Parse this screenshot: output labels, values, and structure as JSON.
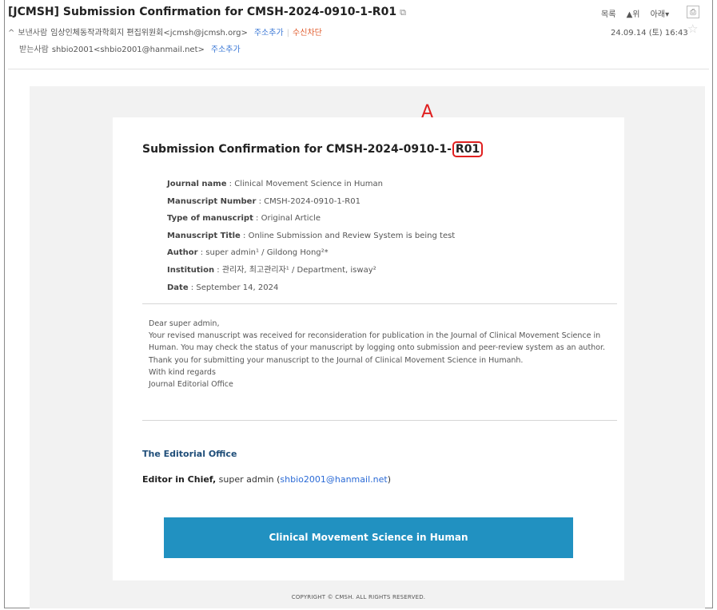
{
  "header": {
    "subject": "[JCMSH] Submission Confirmation for CMSH-2024-0910-1-R01",
    "sender_label": "보낸사람",
    "sender": "임상인체동작과학회지 편집위원회<jcmsh@jcmsh.org>",
    "recipient_label": "받는사람",
    "recipient": "shbio2001<shbio2001@hanmail.net>",
    "add_contact": "주소추가",
    "block_sender": "수신차단",
    "nav_list": "목록",
    "nav_up": "▲위",
    "nav_down": "아래▾",
    "received_at": "24.09.14 (토) 16:43"
  },
  "annotation": {
    "marker": "A"
  },
  "body": {
    "title_prefix": "Submission Confirmation for CMSH-2024-0910-1-",
    "title_suffix": "R01",
    "meta": [
      {
        "label": "Journal name",
        "value": " : Clinical Movement Science in Human"
      },
      {
        "label": "Manuscript Number",
        "value": " : CMSH-2024-0910-1-R01"
      },
      {
        "label": "Type of manuscript",
        "value": " : Original Article"
      },
      {
        "label": "Manuscript Title",
        "value": " : Online Submission and Review System is being test"
      },
      {
        "label": "Author",
        "value": " : super admin¹ / Gildong Hong²*"
      },
      {
        "label": "Institution",
        "value": " : 관리자, 최고관리자¹ / Department, isway²"
      },
      {
        "label": "Date",
        "value": " : September 14, 2024"
      }
    ],
    "letter": [
      "Dear super admin,",
      "Your revised manuscript was received for reconsideration for publication in the Journal of Clinical Movement Science in Human. You may check the status of your manuscript by logging onto submission and peer-review system as an author.",
      "Thank you for submitting your manuscript to the Journal of Clinical Movement Science in Humanh.",
      "With kind regards",
      "Journal Editorial Office"
    ],
    "office_heading": "The Editorial Office",
    "eic_label": "Editor in Chief,",
    "eic_name": " super admin (",
    "eic_email": "shbio2001@hanmail.net",
    "eic_close": ")",
    "banner": "Clinical Movement Science in Human",
    "copyright": "COPYRIGHT © CMSH. ALL RIGHTS RESERVED."
  }
}
